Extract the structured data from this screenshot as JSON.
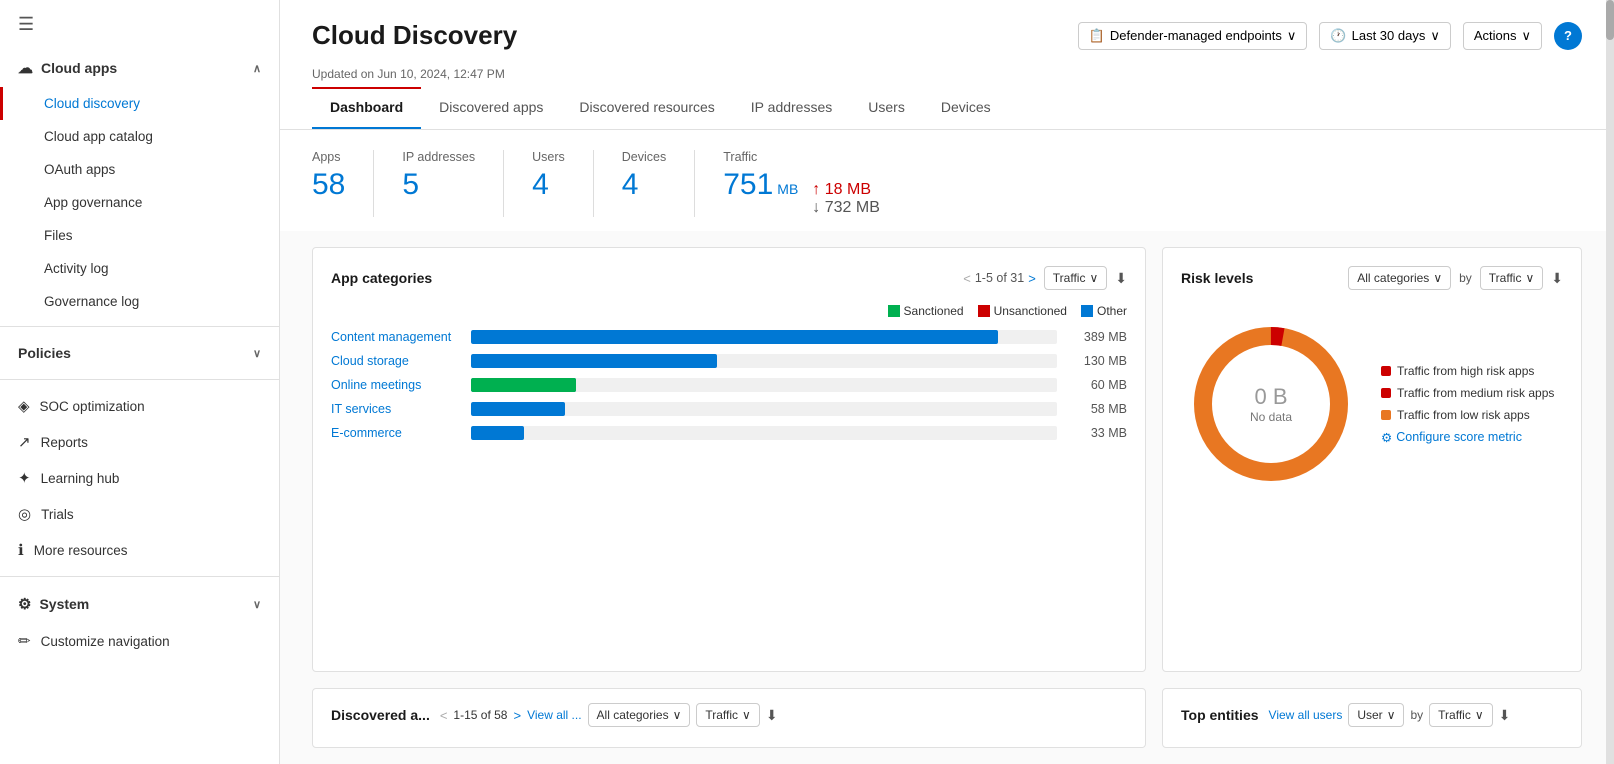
{
  "sidebar": {
    "hamburger_icon": "☰",
    "cloud_apps_label": "Cloud apps",
    "cloud_apps_chevron": "∧",
    "items": [
      {
        "id": "cloud-discovery",
        "label": "Cloud discovery",
        "active": true
      },
      {
        "id": "cloud-app-catalog",
        "label": "Cloud app catalog",
        "active": false
      },
      {
        "id": "oauth-apps",
        "label": "OAuth apps",
        "active": false
      },
      {
        "id": "app-governance",
        "label": "App governance",
        "active": false
      },
      {
        "id": "files",
        "label": "Files",
        "active": false
      },
      {
        "id": "activity-log",
        "label": "Activity log",
        "active": false
      },
      {
        "id": "governance-log",
        "label": "Governance log",
        "active": false
      }
    ],
    "policies_label": "Policies",
    "policies_chevron": "∨",
    "soc_label": "SOC optimization",
    "reports_label": "Reports",
    "learning_hub_label": "Learning hub",
    "trials_label": "Trials",
    "more_resources_label": "More resources",
    "system_label": "System",
    "system_chevron": "∨",
    "customize_nav_label": "Customize navigation"
  },
  "header": {
    "title": "Cloud Discovery",
    "endpoints_label": "Defender-managed endpoints",
    "time_label": "Last 30 days",
    "actions_label": "Actions",
    "help_label": "?",
    "endpoints_icon": "📋",
    "time_icon": "🕐"
  },
  "updated_text": "Updated on Jun 10, 2024, 12:47 PM",
  "tabs": [
    {
      "id": "dashboard",
      "label": "Dashboard",
      "active": true
    },
    {
      "id": "discovered-apps",
      "label": "Discovered apps",
      "active": false
    },
    {
      "id": "discovered-resources",
      "label": "Discovered resources",
      "active": false
    },
    {
      "id": "ip-addresses",
      "label": "IP addresses",
      "active": false
    },
    {
      "id": "users",
      "label": "Users",
      "active": false
    },
    {
      "id": "devices",
      "label": "Devices",
      "active": false
    }
  ],
  "stats": {
    "apps_label": "Apps",
    "apps_value": "58",
    "ip_label": "IP addresses",
    "ip_value": "5",
    "users_label": "Users",
    "users_value": "4",
    "devices_label": "Devices",
    "devices_value": "4",
    "traffic_label": "Traffic",
    "traffic_main": "751",
    "traffic_unit": "MB",
    "traffic_up": "18 MB",
    "traffic_down": "732 MB",
    "up_arrow": "↑",
    "down_arrow": "↓"
  },
  "app_categories": {
    "title": "App categories",
    "pagination": "1-5 of 31",
    "prev_arrow": "<",
    "next_arrow": ">",
    "dropdown_label": "Traffic",
    "download_icon": "⬇",
    "legend": [
      {
        "label": "Sanctioned",
        "color": "#00b050"
      },
      {
        "label": "Unsanctioned",
        "color": "#cc0000"
      },
      {
        "label": "Other",
        "color": "#0078d4"
      }
    ],
    "bars": [
      {
        "label": "Content management",
        "value": "389 MB",
        "pct_blue": 90,
        "pct_green": 0,
        "color": "#0078d4"
      },
      {
        "label": "Cloud storage",
        "value": "130 MB",
        "pct_blue": 42,
        "pct_green": 0,
        "color": "#0078d4"
      },
      {
        "label": "Online meetings",
        "value": "60 MB",
        "pct_blue": 18,
        "pct_green": 18,
        "color_green": "#00b050",
        "has_green": true
      },
      {
        "label": "IT services",
        "value": "58 MB",
        "pct_blue": 16,
        "pct_green": 0,
        "color": "#0078d4"
      },
      {
        "label": "E-commerce",
        "value": "33 MB",
        "pct_blue": 9,
        "pct_green": 0,
        "color": "#0078d4"
      }
    ]
  },
  "risk_levels": {
    "title": "Risk levels",
    "categories_label": "All categories",
    "by_label": "by",
    "traffic_label": "Traffic",
    "download_icon": "⬇",
    "donut": {
      "center_value": "0 B",
      "center_label": "No data"
    },
    "legend": [
      {
        "label": "Traffic from high risk apps",
        "color": "#cc0000"
      },
      {
        "label": "Traffic from medium risk apps",
        "color": "#cc0000"
      },
      {
        "label": "Traffic from low risk apps",
        "color": "#e87722"
      }
    ],
    "configure_icon": "⚙",
    "configure_label": "Configure score metric"
  },
  "bottom_left": {
    "title": "Discovered a...",
    "pagination": "1-15 of 58",
    "view_all_label": "View all ...",
    "categories_label": "All categories",
    "traffic_label": "Traffic",
    "download_icon": "⬇"
  },
  "bottom_right": {
    "title": "Top entities",
    "view_all_label": "View all users",
    "user_label": "User",
    "by_label": "by",
    "traffic_label": "Traffic",
    "download_icon": "⬇"
  }
}
